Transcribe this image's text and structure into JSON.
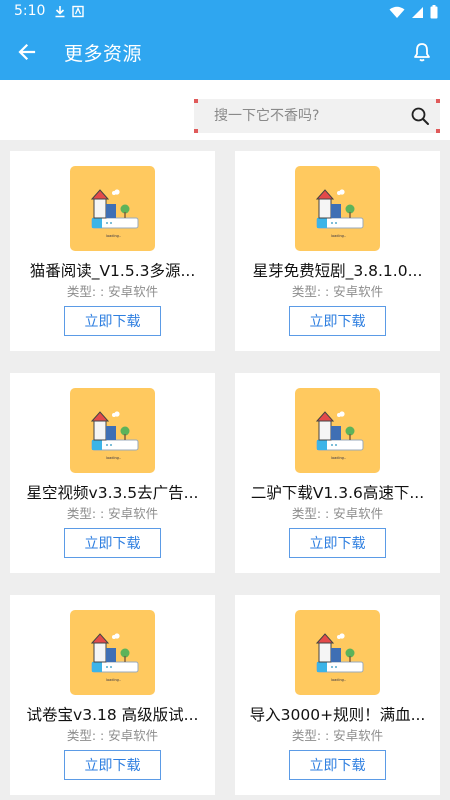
{
  "status_bar": {
    "time": "5:10"
  },
  "app_bar": {
    "title": "更多资源"
  },
  "search": {
    "placeholder": "搜一下它不香吗?"
  },
  "items": [
    {
      "name": "猫番阅读_V1.5.3多源...",
      "type": "类型: : 安卓软件",
      "button": "立即下载"
    },
    {
      "name": "星芽免费短剧_3.8.1.0...",
      "type": "类型: : 安卓软件",
      "button": "立即下载"
    },
    {
      "name": "星空视频v3.3.5去广告...",
      "type": "类型: : 安卓软件",
      "button": "立即下载"
    },
    {
      "name": "二驴下载V1.3.6高速下...",
      "type": "类型: : 安卓软件",
      "button": "立即下载"
    },
    {
      "name": "试卷宝v3.18 高级版试...",
      "type": "类型: : 安卓软件",
      "button": "立即下载"
    },
    {
      "name": "导入3000+规则！满血...",
      "type": "类型: : 安卓软件",
      "button": "立即下载"
    }
  ],
  "colors": {
    "primary": "#2fa6f0",
    "icon_bg": "#ffc95f",
    "button_border": "#5b9be6",
    "background": "#eeeeee"
  },
  "icons": [
    "download-icon",
    "store-icon",
    "wifi-icon",
    "signal-icon",
    "battery-icon",
    "back-arrow-icon",
    "bell-icon",
    "search-icon"
  ]
}
